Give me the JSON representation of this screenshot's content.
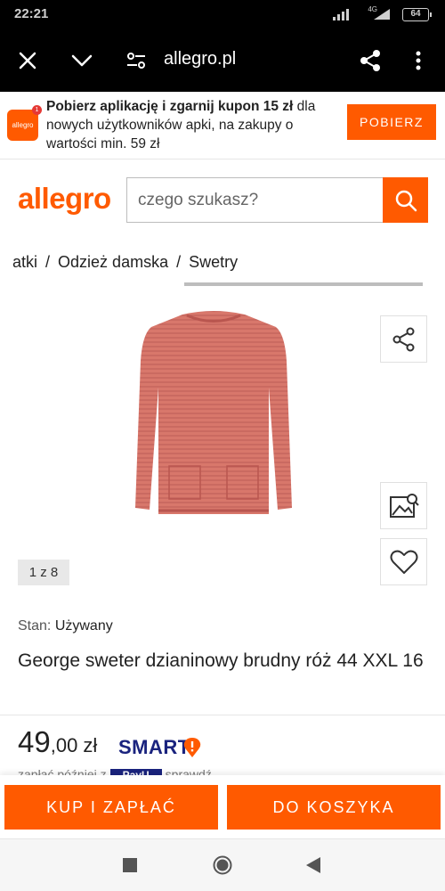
{
  "status_bar": {
    "time": "22:21",
    "network": "4G",
    "battery": "64"
  },
  "browser": {
    "url": "allegro.pl",
    "icons": [
      "close-icon",
      "chevron-down-icon",
      "site-settings-icon",
      "share-icon",
      "more-vert-icon"
    ]
  },
  "app_banner": {
    "logo_text": "allegro",
    "badge": "1",
    "bold_text": "Pobierz aplikację i zgarnij kupon 15 zł",
    "rest_text": " dla nowych użytkowników apki, na zakupy o wartości min. 59 zł",
    "button": "POBIERZ"
  },
  "header": {
    "brand": "allegro",
    "search_placeholder": "czego szukasz?"
  },
  "breadcrumb": {
    "items": [
      "atki",
      "Odzież damska",
      "Swetry"
    ],
    "separator": "/"
  },
  "gallery": {
    "counter": "1 z 8"
  },
  "product": {
    "condition_label": "Stan:",
    "condition_value": "Używany",
    "title": "George sweter dzianinowy brudny róż 44 XXL 16",
    "price_main": "49",
    "price_cents": ",00",
    "currency": "zł",
    "smart_label": "SMART",
    "pay_later_before": "zapłać później z",
    "pay_later_logo": "PayU",
    "pay_later_after": "sprawdź"
  },
  "actions": {
    "buy": "KUP I ZAPŁAĆ",
    "cart": "DO KOSZYKA"
  },
  "colors": {
    "accent": "#ff5a00",
    "smart": "#1a237e"
  }
}
